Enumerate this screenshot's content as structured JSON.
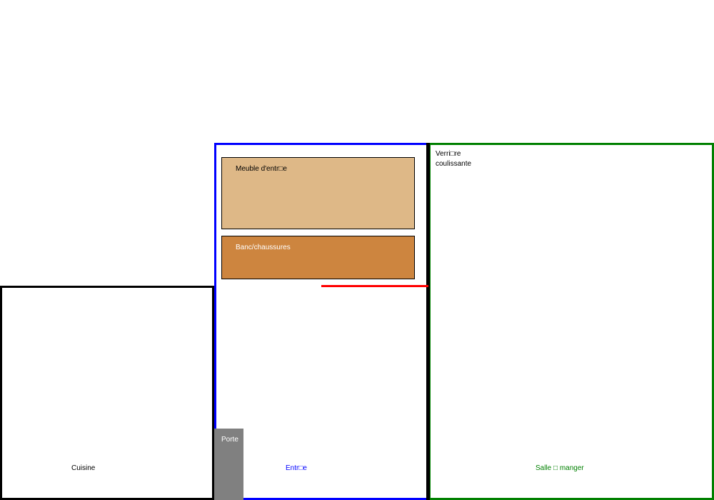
{
  "rooms": {
    "kitchen": {
      "label": "Cuisine",
      "color": "#000000"
    },
    "entry": {
      "label": "Entr□e",
      "color": "#0000ff"
    },
    "dining": {
      "label": "Salle □ manger",
      "color": "#008000"
    }
  },
  "furniture": {
    "entry_cabinet": {
      "label": "Meuble d'entr□e",
      "color": "#deb887"
    },
    "shoe_bench": {
      "label": "Banc/chaussures",
      "color": "#cd853f"
    }
  },
  "door": {
    "label": "Porte",
    "color": "#808080"
  },
  "sliding_glass": {
    "label_line1": "Verri□re",
    "label_line2": "coulissante",
    "line_color": "#ff0000"
  }
}
